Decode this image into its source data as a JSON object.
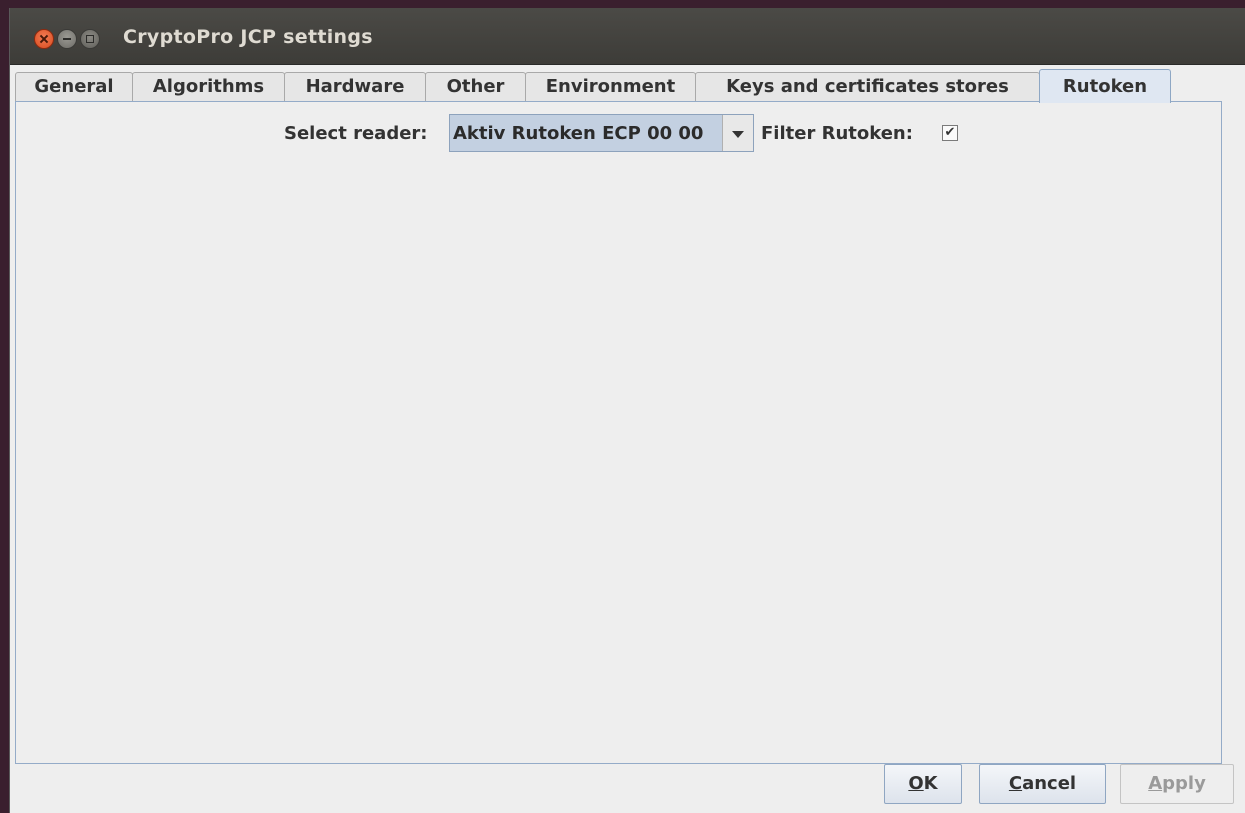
{
  "window": {
    "title": "CryptoPro JCP settings"
  },
  "tabs": [
    {
      "label": "General",
      "active": false
    },
    {
      "label": "Algorithms",
      "active": false
    },
    {
      "label": "Hardware",
      "active": false
    },
    {
      "label": "Other",
      "active": false
    },
    {
      "label": "Environment",
      "active": false
    },
    {
      "label": "Keys and certificates stores",
      "active": false
    },
    {
      "label": "Rutoken",
      "active": true
    }
  ],
  "rutoken": {
    "select_reader_label": "Select reader:",
    "reader_value": "Aktiv Rutoken ECP 00 00",
    "filter_label": "Filter Rutoken:",
    "filter_checked": true,
    "check_glyph": "✔"
  },
  "buttons": {
    "ok": {
      "mnemonic": "O",
      "rest": "K",
      "enabled": true
    },
    "cancel": {
      "mnemonic": "C",
      "rest": "ancel",
      "enabled": true
    },
    "apply": {
      "mnemonic": "A",
      "rest": "pply",
      "enabled": false
    }
  },
  "icons": {
    "close": "close-icon",
    "minimize": "minimize-icon",
    "maximize": "maximize-icon",
    "dropdown": "chevron-down-icon",
    "check": "checkmark-icon"
  },
  "colors": {
    "titlebar": "#3d3c38",
    "close_button": "#e05a2f",
    "panel_border": "#94abc8",
    "active_tab": "#dfe7f2",
    "combo_selection": "#c3d0e1"
  }
}
